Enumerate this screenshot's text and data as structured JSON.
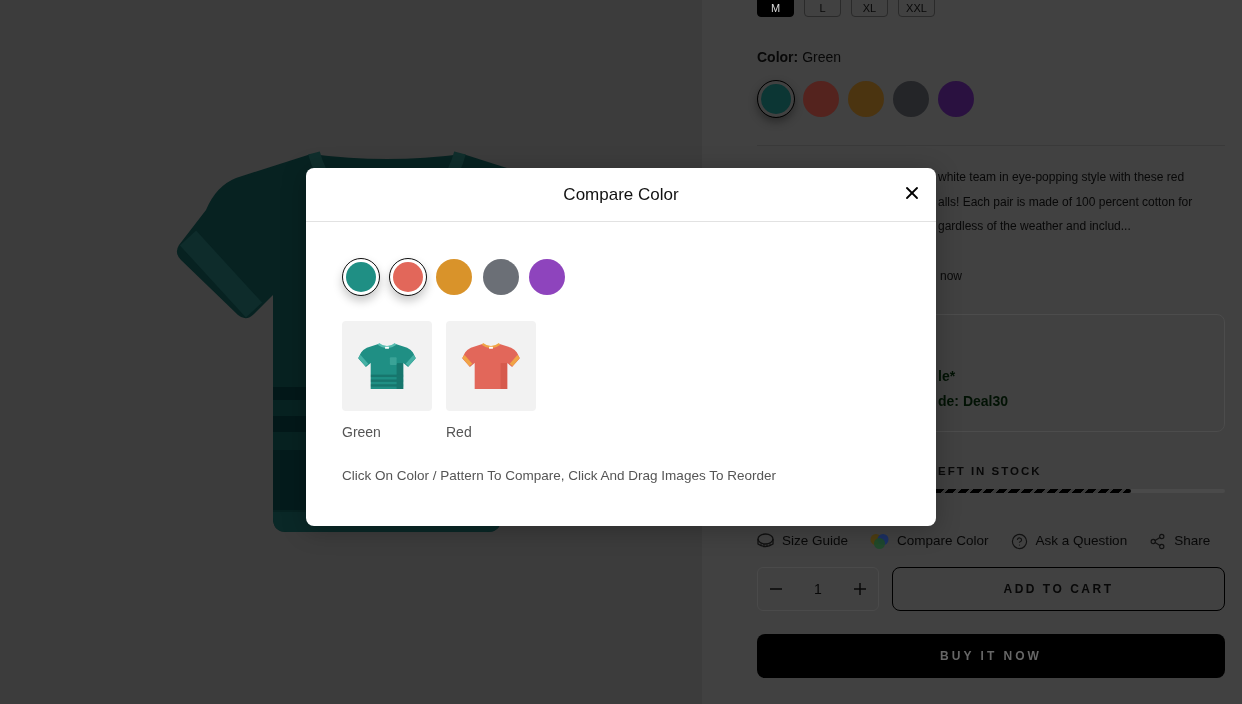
{
  "sizes": [
    {
      "label": "M",
      "selected": true
    },
    {
      "label": "L",
      "selected": false
    },
    {
      "label": "XL",
      "selected": false
    },
    {
      "label": "XXL",
      "selected": false
    }
  ],
  "color_picker": {
    "label": "Color:",
    "value": "Green",
    "swatches": [
      {
        "color": "#0c3634",
        "selected": true
      },
      {
        "color": "#54231e",
        "selected": false
      },
      {
        "color": "#4b3410",
        "selected": false
      },
      {
        "color": "#242528",
        "selected": false
      },
      {
        "color": "#2a1140",
        "selected": false
      }
    ]
  },
  "description_lines": [
    "white team in eye-popping style with these red",
    "alls! Each pair is made of 100 percent cotton for",
    "gardless of the weather and includ..."
  ],
  "link_fragment": "now",
  "offer_lines": [
    "le*",
    "de: Deal30"
  ],
  "stock": {
    "label": "EFT IN STOCK",
    "level": 0.8
  },
  "actions": [
    {
      "kind": "size_guide",
      "label": "Size Guide"
    },
    {
      "kind": "compare_color",
      "label": "Compare Color"
    },
    {
      "kind": "ask",
      "label": "Ask a Question"
    },
    {
      "kind": "share",
      "label": "Share"
    }
  ],
  "quantity": {
    "value": "1"
  },
  "buttons": {
    "add_to_cart": "ADD TO CART",
    "buy_now": "BUY IT NOW"
  },
  "modal": {
    "title": "Compare Color",
    "swatches": [
      {
        "color": "#1f8f84",
        "selected": true
      },
      {
        "color": "#e2675a",
        "selected": true
      },
      {
        "color": "#d9932a",
        "selected": false
      },
      {
        "color": "#6b6f76",
        "selected": false
      },
      {
        "color": "#8e44bd",
        "selected": false
      }
    ],
    "images": [
      {
        "label": "Green",
        "kind": "striped"
      },
      {
        "label": "Red",
        "kind": "ringer"
      }
    ],
    "hint": "Click On Color / Pattern To Compare, Click And Drag Images To Reorder"
  }
}
